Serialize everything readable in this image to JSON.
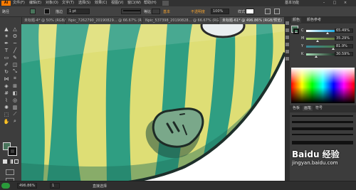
{
  "app": {
    "logo": "Ai",
    "menu": [
      "文件(F)",
      "编辑(E)",
      "对象(O)",
      "文字(T)",
      "选择(S)",
      "效果(C)",
      "视图(V)",
      "窗口(W)",
      "帮助(H)"
    ],
    "workspace": "基本功能"
  },
  "control": {
    "path_label": "路径",
    "stroke_label": "描边",
    "stroke_weight": "1 pt",
    "profile_label": "等比",
    "brush_label": "基本",
    "opacity_label": "不透明度",
    "opacity_value": "100%",
    "style_label": "样式"
  },
  "tabs": [
    "未标题-4* @ 50% (RGB/预览)",
    "Npic_7262790_20190829... @ 66.67% (RGB/预览)",
    "Npic_537398_20190828... @ 66.67% (RGB/预览)",
    "未标题-61* @ 496.86% (RGB/预览)"
  ],
  "panels": {
    "color_tab": "颜色",
    "guide_tab": "颜色参考",
    "sliders": [
      {
        "label": "C",
        "value": "65.49%",
        "level": 0.65
      },
      {
        "label": "M",
        "value": "35.29%",
        "level": 0.35
      },
      {
        "label": "Y",
        "value": "81.9%",
        "level": 0.82
      },
      {
        "label": "K",
        "value": "30.59%",
        "level": 0.31
      }
    ],
    "bottom_tabs": [
      "色板",
      "画笔",
      "符号"
    ],
    "accent": "#48745b"
  },
  "status": {
    "zoom": "496.86%",
    "page": "1",
    "tool": "直接选择"
  },
  "watermark": {
    "text": "Baidu 经验",
    "url": "jingyan.baidu.com"
  }
}
